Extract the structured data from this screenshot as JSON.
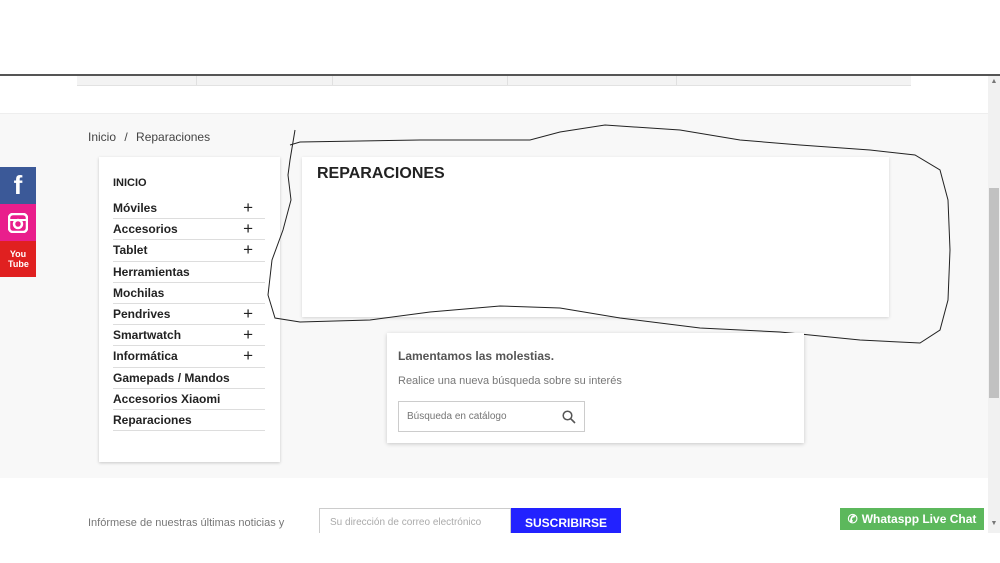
{
  "breadcrumb": {
    "home": "Inicio",
    "sep": "/",
    "current": "Reparaciones"
  },
  "social": [
    {
      "name": "facebook",
      "color": "#3b5998",
      "glyph": "f"
    },
    {
      "name": "instagram",
      "color": "#e91e8c",
      "glyph": "◙"
    },
    {
      "name": "youtube",
      "color": "#e02020",
      "glyph": "You Tube"
    }
  ],
  "sidebar": {
    "title": "INICIO",
    "items": [
      {
        "label": "Móviles",
        "expand": "+"
      },
      {
        "label": "Accesorios",
        "expand": "+"
      },
      {
        "label": "Tablet",
        "expand": "+"
      },
      {
        "label": "Herramientas"
      },
      {
        "label": "Mochilas"
      },
      {
        "label": "Pendrives",
        "expand": "+"
      },
      {
        "label": "Smartwatch",
        "expand": "+"
      },
      {
        "label": "Informática",
        "expand": "+"
      },
      {
        "label": "Gamepads / Mandos"
      },
      {
        "label": "Accesorios Xiaomi"
      },
      {
        "label": "Reparaciones"
      }
    ]
  },
  "content": {
    "title": "REPARACIONES"
  },
  "notice": {
    "title": "Lamentamos las molestias.",
    "text": "Realice una nueva búsqueda sobre su interés",
    "search_placeholder": "Búsqueda en catálogo"
  },
  "newsletter": {
    "text": "Infórmese de nuestras últimas noticias y",
    "placeholder": "Su dirección de correo electrónico",
    "button": "SUSCRIBIRSE"
  },
  "whatsapp": {
    "label": "Whataspp Live Chat",
    "color": "#5cb85c"
  }
}
